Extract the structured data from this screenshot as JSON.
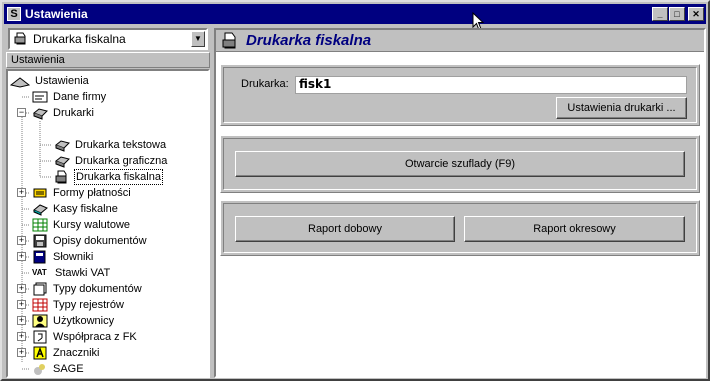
{
  "window": {
    "title": "Ustawienia",
    "app_icon_letter": "S"
  },
  "combo": {
    "value": "Drukarka fiskalna"
  },
  "left_pane": {
    "header": "Ustawienia"
  },
  "tree": {
    "root": "Ustawienia",
    "dane_firmy": "Dane firmy",
    "drukarki": "Drukarki",
    "drukarka_tekstowa": "Drukarka tekstowa",
    "drukarka_graficzna": "Drukarka graficzna",
    "drukarka_fiskalna": "Drukarka fiskalna",
    "formy_platnosci": "Formy płatności",
    "kasy_fiskalne": "Kasy fiskalne",
    "kursy_walutowe": "Kursy walutowe",
    "opisy_dokumentow": "Opisy dokumentów",
    "slowniki": "Słowniki",
    "stawki_vat": "Stawki VAT",
    "vat_icon_text": "VAT",
    "typy_dokumentow": "Typy dokumentów",
    "typy_rejestrow": "Typy rejestrów",
    "uzytkownicy": "Użytkownicy",
    "wspolpraca_fk": "Współpraca z FK",
    "znaczniki": "Znaczniki",
    "sage": "SAGE"
  },
  "right_pane": {
    "title": "Drukarka fiskalna",
    "drukarka_label": "Drukarka:",
    "drukarka_value": "fisk1",
    "ustawienia_button": "Ustawienia drukarki ...",
    "otwarcie_button": "Otwarcie szuflady (F9)",
    "raport_dobowy_button": "Raport dobowy",
    "raport_okresowy_button": "Raport okresowy"
  },
  "colors": {
    "titlebar": "#000080",
    "title_text": "#000080",
    "face": "#c0c0c0"
  },
  "icons": [
    "printer-icon",
    "computer-icon",
    "card-icon",
    "money-icon",
    "table-icon",
    "disk-icon",
    "book-icon",
    "doc-icon",
    "grid-icon",
    "users-icon",
    "link-icon",
    "tag-icon",
    "sage-icon"
  ]
}
